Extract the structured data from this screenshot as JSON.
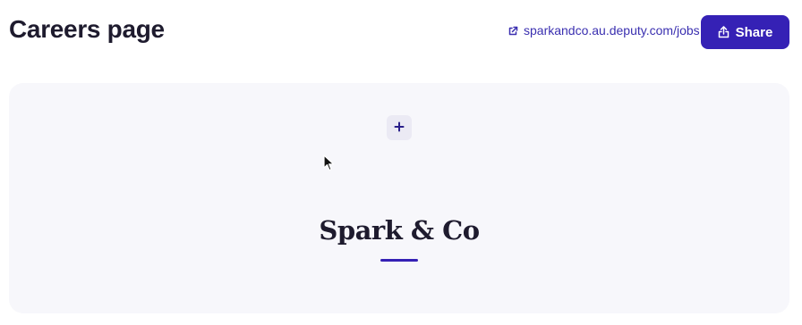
{
  "header": {
    "title": "Careers page",
    "jobs_link_text": "sparkandco.au.deputy.com/jobs",
    "share_label": "Share"
  },
  "canvas": {
    "company_name": "Spark & Co"
  },
  "icons": {
    "external_link": "external-link-icon",
    "share": "share-icon",
    "add": "plus-icon",
    "cursor": "mouse-pointer-icon"
  },
  "colors": {
    "accent": "#3521b5",
    "link": "#3a2fb0",
    "title": "#1e1b2e",
    "canvas_background": "#f7f7fb"
  }
}
